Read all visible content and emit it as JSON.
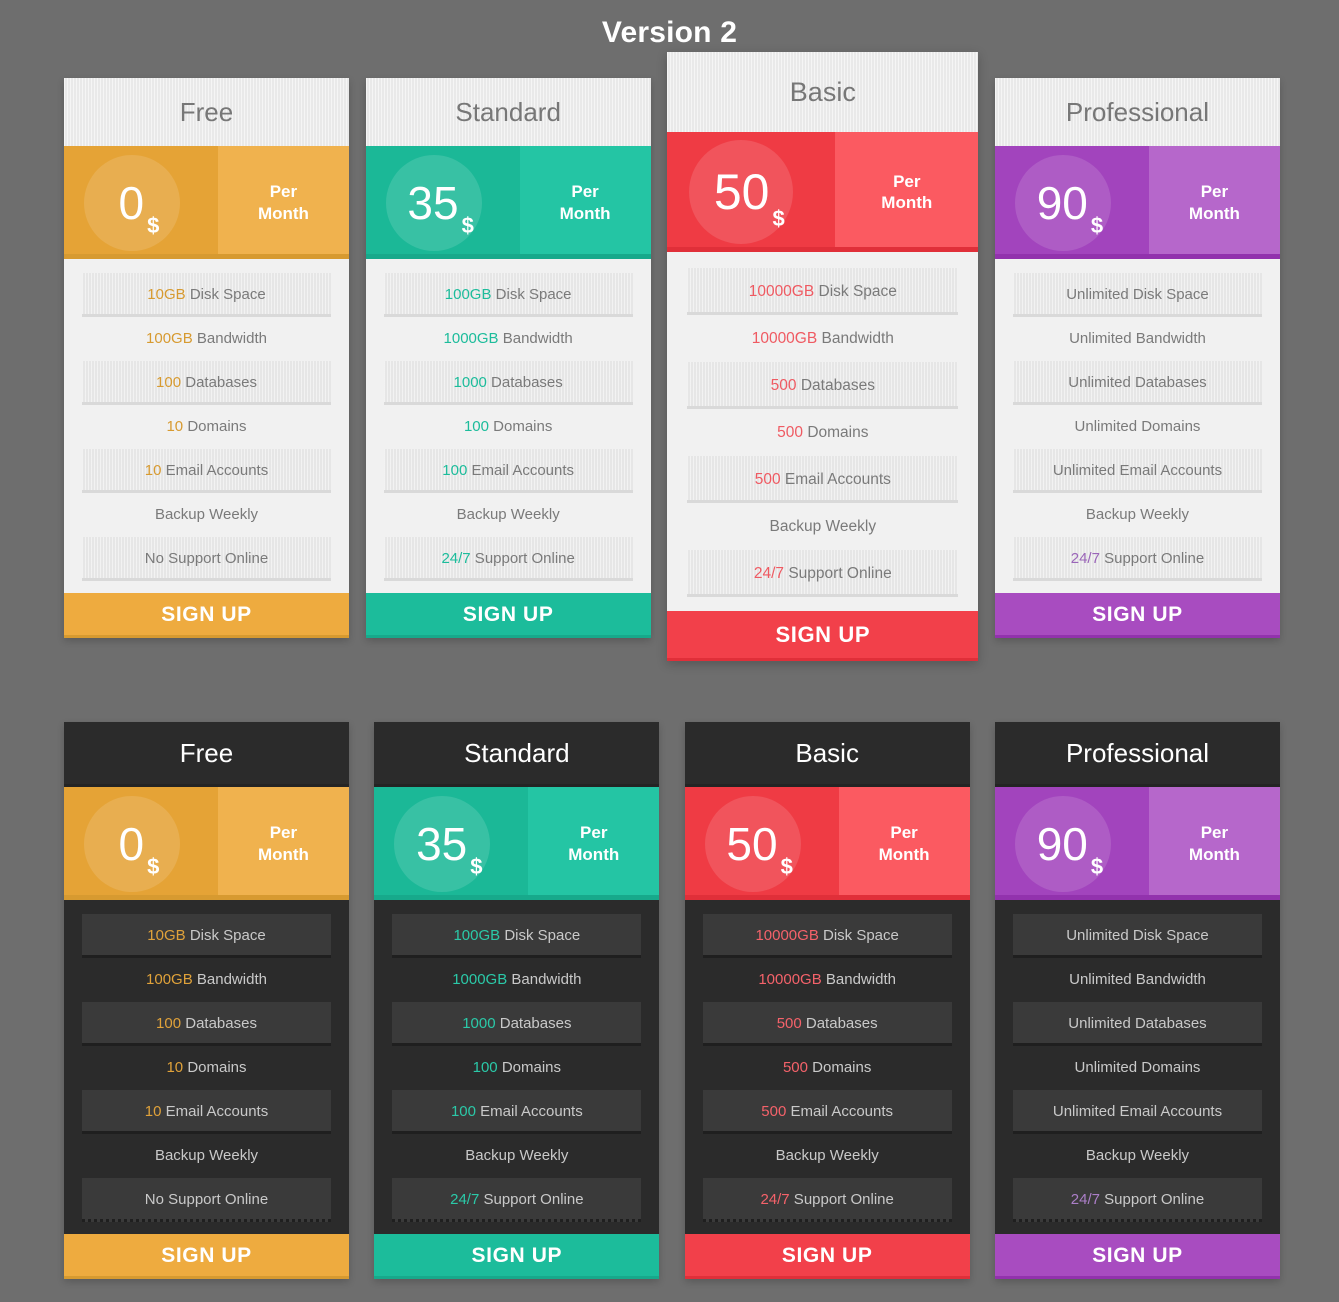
{
  "page": {
    "title": "Version 2",
    "background_color": "#6e6e6e"
  },
  "labels": {
    "per_month": "Per\nMonth",
    "signup": "SIGN UP",
    "currency": "$"
  },
  "plans": [
    {
      "name": "Free",
      "price": "0",
      "currency": "$",
      "period": "Per Month",
      "accent": "#eeab3f",
      "accent_dark": "#e5a336",
      "accent_light": "#f0b24e",
      "accent_underline": "#d79a30",
      "highlight_color": "#d79a30",
      "highlight_color_dark": "#e0a23a",
      "signup_label": "SIGN UP",
      "features": [
        {
          "value": "10GB",
          "text": " Disk Space"
        },
        {
          "value": "100GB",
          "text": " Bandwidth"
        },
        {
          "value": "100",
          "text": " Databases"
        },
        {
          "value": "10",
          "text": " Domains"
        },
        {
          "value": "10",
          "text": " Email Accounts"
        },
        {
          "value": "",
          "text": "Backup Weekly"
        },
        {
          "value": "",
          "text": "No Support Online"
        }
      ]
    },
    {
      "name": "Standard",
      "price": "35",
      "currency": "$",
      "period": "Per Month",
      "accent": "#1cbc9b",
      "accent_dark": "#1bb897",
      "accent_light": "#24c5a4",
      "accent_underline": "#17a98b",
      "highlight_color": "#1cbc9b",
      "highlight_color_dark": "#2bc9a8",
      "signup_label": "SIGN UP",
      "features": [
        {
          "value": "100GB",
          "text": " Disk Space"
        },
        {
          "value": "1000GB",
          "text": " Bandwidth"
        },
        {
          "value": "1000",
          "text": " Databases"
        },
        {
          "value": "100",
          "text": " Domains"
        },
        {
          "value": "100",
          "text": " Email Accounts"
        },
        {
          "value": "",
          "text": "Backup Weekly"
        },
        {
          "value": "24/7",
          "text": " Support Online"
        }
      ]
    },
    {
      "name": "Basic",
      "price": "50",
      "currency": "$",
      "period": "Per Month",
      "accent": "#f2404a",
      "accent_dark": "#ef3b44",
      "accent_light": "#fb5a61",
      "accent_underline": "#e02f39",
      "highlight_color": "#ef5a62",
      "highlight_color_dark": "#f4626a",
      "signup_label": "SIGN UP",
      "featured": true,
      "features": [
        {
          "value": "10000GB",
          "text": " Disk Space"
        },
        {
          "value": "10000GB",
          "text": " Bandwidth"
        },
        {
          "value": "500",
          "text": " Databases"
        },
        {
          "value": "500",
          "text": " Domains"
        },
        {
          "value": "500",
          "text": " Email Accounts"
        },
        {
          "value": "",
          "text": "Backup Weekly"
        },
        {
          "value": "24/7",
          "text": " Support Online"
        }
      ]
    },
    {
      "name": "Professional",
      "price": "90",
      "currency": "$",
      "period": "Per Month",
      "accent": "#a84cc0",
      "accent_dark": "#a244bd",
      "accent_light": "#b667cb",
      "accent_underline": "#9232ad",
      "highlight_color": "#9a65b8",
      "highlight_color_dark": "#ab7ec7",
      "signup_label": "SIGN UP",
      "features": [
        {
          "value": "",
          "text": "Unlimited Disk Space"
        },
        {
          "value": "",
          "text": "Unlimited Bandwidth"
        },
        {
          "value": "",
          "text": "Unlimited Databases"
        },
        {
          "value": "",
          "text": "Unlimited Domains"
        },
        {
          "value": "",
          "text": "Unlimited Email Accounts"
        },
        {
          "value": "",
          "text": "Backup Weekly"
        },
        {
          "value": "24/7",
          "text": " Support Online"
        }
      ]
    }
  ],
  "themes": [
    {
      "id": "light",
      "header_bg": "#e9e9e9",
      "header_text": "#777777",
      "body_bg": "#f1f1f1"
    },
    {
      "id": "dark",
      "header_bg": "#2b2b2b",
      "header_text": "#ffffff",
      "body_bg": "#2b2b2b"
    }
  ]
}
